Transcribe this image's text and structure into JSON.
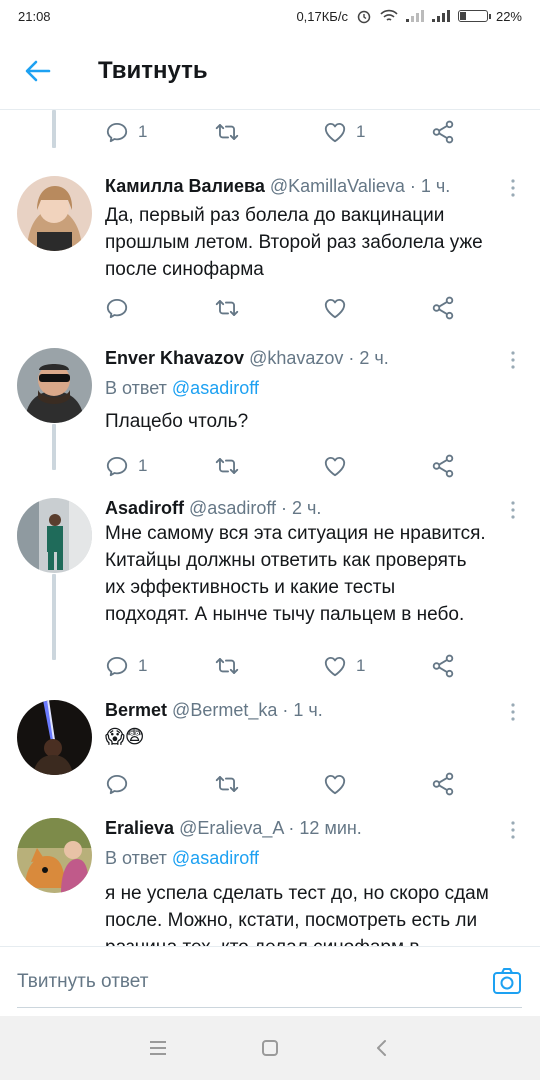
{
  "status": {
    "time": "21:08",
    "speed": "0,17КБ/с",
    "battery_pct": "22%",
    "battery_level": 0.22
  },
  "header": {
    "title": "Твитнуть"
  },
  "top_actions": {
    "replies": "1",
    "likes": "1"
  },
  "tweets": [
    {
      "name": "Камилла Валиева",
      "handle": "@KamillaValieva",
      "time": "· 1 ч.",
      "reply_to_label": "",
      "reply_to": "",
      "lines": [
        "Да, первый раз болела до вакцинации",
        "прошлым летом. Второй раз заболела уже",
        "после синофарма"
      ],
      "replies": "",
      "likes": ""
    },
    {
      "name": "Enver Khavazov",
      "handle": "@khavazov",
      "time": "· 2 ч.",
      "reply_to_label": "В ответ",
      "reply_to": "@asadiroff",
      "lines": [
        "Плацебо чтоль?"
      ],
      "replies": "1",
      "likes": ""
    },
    {
      "name": "Asadiroff",
      "handle": "@asadiroff",
      "time": "· 2 ч.",
      "reply_to_label": "",
      "reply_to": "",
      "lines": [
        "Мне самому вся эта ситуация не нравится.",
        "Китайцы должны ответить как проверять",
        "их эффективность и какие тесты",
        "подходят. А нынче тычу пальцем в небо."
      ],
      "replies": "1",
      "likes": "1"
    },
    {
      "name": "Bermet",
      "handle": "@Bermet_ka",
      "time": "· 1 ч.",
      "reply_to_label": "",
      "reply_to": "",
      "lines": [
        "😱😨"
      ],
      "replies": "",
      "likes": ""
    },
    {
      "name": "Eralieva",
      "handle": "@Eralieva_A",
      "time": "· 12 мин.",
      "reply_to_label": "В ответ",
      "reply_to": "@asadiroff",
      "lines": [
        "я не успела сделать тест до, но скоро сдам",
        "после. Можно, кстати, посмотреть есть ли",
        "разница тех, кто делал синофарм в"
      ],
      "replies": "",
      "likes": ""
    }
  ],
  "composer": {
    "placeholder": "Твитнуть ответ"
  },
  "icons": [
    "back-arrow-icon",
    "reply-icon",
    "retweet-icon",
    "like-icon",
    "share-icon",
    "more-icon",
    "camera-icon",
    "menu-icon",
    "home-square-icon",
    "back-triangle-icon"
  ],
  "colors": {
    "accent": "#1da1f2",
    "secondary_text": "#657786",
    "divider": "#e6ecf0"
  }
}
